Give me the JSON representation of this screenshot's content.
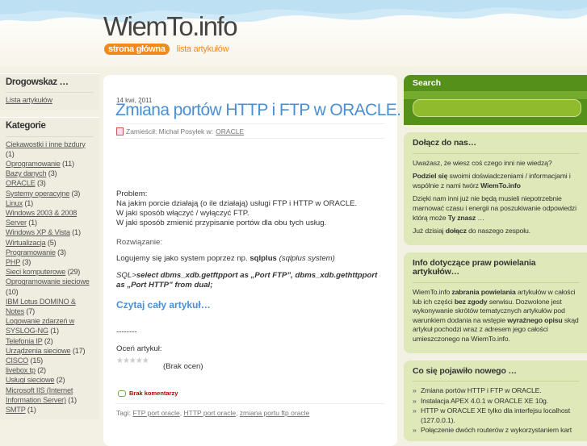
{
  "site": {
    "title": "WiemTo.info"
  },
  "nav": {
    "home": "strona główna",
    "articles": "lista artykułów"
  },
  "left": {
    "drogowskaz": {
      "heading": "Drogowskaz …",
      "link": "Lista artykułów"
    },
    "kategorie": {
      "heading": "Kategorie",
      "items": [
        {
          "name": "Ciekawostki i inne bzdury",
          "count": "(1)"
        },
        {
          "name": "Oprogramowanie",
          "count": "(11)"
        },
        {
          "name": "Bazy danych",
          "count": "(3)"
        },
        {
          "name": "ORACLE",
          "count": "(3)"
        },
        {
          "name": "Systemy operacyjne",
          "count": "(3)"
        },
        {
          "name": "Linux",
          "count": "(1)"
        },
        {
          "name": "Windows 2003 & 2008 Server",
          "count": "(1)"
        },
        {
          "name": "Windows XP & Vista",
          "count": "(1)"
        },
        {
          "name": "Wirtualizacja",
          "count": "(5)"
        },
        {
          "name": "Programowanie",
          "count": "(3)"
        },
        {
          "name": "PHP",
          "count": "(3)"
        },
        {
          "name": "Sieci komputerowe",
          "count": "(29)"
        },
        {
          "name": "Oprogramowanie sieciowe",
          "count": "(10)"
        },
        {
          "name": "IBM Lotus DOMINO & Notes",
          "count": "(7)"
        },
        {
          "name": "Logowanie zdarzeń w SYSLOG-NG",
          "count": "(1)"
        },
        {
          "name": "Telefonia IP",
          "count": "(2)"
        },
        {
          "name": "Urządzenia sieciowe",
          "count": "(17)"
        },
        {
          "name": "CISCO",
          "count": "(15)"
        },
        {
          "name": "livebox tp",
          "count": "(2)"
        },
        {
          "name": "Usługi sieciowe",
          "count": "(2)"
        },
        {
          "name": "Microsoft IIS (Internet Information Server)",
          "count": "(1)"
        },
        {
          "name": "SMTP",
          "count": "(1)"
        }
      ]
    }
  },
  "post": {
    "date": "14 kwi, 2011",
    "title": "Zmiana portów HTTP i FTP w ORACLE.",
    "meta_prefix": "Zamieścił: Michał Posyłek w:",
    "meta_category": "ORACLE",
    "problem": [
      "Problem:",
      "Na jakim porcie działają (o ile działają) usługi FTP i HTTP w ORACLE.",
      "W jaki sposób włączyć / wyłączyć FTP.",
      "W jaki sposób zmienić przypisanie portów dla obu tych usług."
    ],
    "rozwiazanie": "Rozwiązanie:",
    "logujemy_pre": "Logujemy się jako system poprzez np. ",
    "logujemy_bold": "sqlplus",
    "logujemy_post": " (sqlplus system)",
    "sql_prefix": "SQL>",
    "sql_bold": "select dbms_xdb.getftpport as „Port FTP”, dbms_xdb.gethttpport as „Port HTTP” from dual;",
    "read_more": "Czytaj cały artykuł…",
    "dashes": "--------",
    "rate_label": "Oceń artykuł:",
    "stars": "★★★★★",
    "no_ratings": "(Brak ocen)",
    "comments": "Brak komentarzy",
    "tags_label": "Tagi:",
    "tags": [
      "FTP port oracle",
      "HTTP port oracle",
      "zmiana portu ftp oracle"
    ]
  },
  "right": {
    "search": {
      "heading": "Search",
      "value": ""
    },
    "join": {
      "heading": "Dołącz do nas…",
      "p1": "Uważasz, że wiesz coś czego inni nie wiedzą?",
      "p2_bold": "Podziel się",
      "p2_rest": " swoimi doświadczeniami / informacjami i wspólnie z nami twórz ",
      "p2_bold2": "WiemTo.info",
      "p3": "Dzięki nam inni już nie będą musieli niepotrzebnie marnować czasu i energii na poszukiwanie odpowiedzi którą może ",
      "p3_bold": "Ty znasz",
      "p3_end": " …",
      "p4_pre": "Już dzisiaj ",
      "p4_bold": "dołącz",
      "p4_post": " do naszego zespołu."
    },
    "copyright": {
      "heading": "Info dotyczące praw powielania artykułów…",
      "t1": "WiemTo.info ",
      "t1_bold": "zabrania powielania",
      "t2": " artykułów w całości lub ich części ",
      "t2_bold": "bez zgody",
      "t3": " serwisu. Dozwolone jest wykonywanie skrótów tematycznych artykułów pod warunkiem dodania na wstępie ",
      "t3_bold": "wyraźnego opisu",
      "t4": " skąd artykuł pochodzi wraz z adresem jego całości umieszczonego na WiemTo.info."
    },
    "new": {
      "heading": "Co się pojawiło nowego …",
      "items": [
        "Zmiana portów HTTP i FTP w ORACLE.",
        "Instalacja APEX 4.0.1 w ORACLE XE 10g.",
        "HTTP w ORACLE XE tylko dla interfejsu localhost (127.0.0.1).",
        "Połączenie dwóch routerów z wykorzystaniem kart"
      ]
    }
  }
}
